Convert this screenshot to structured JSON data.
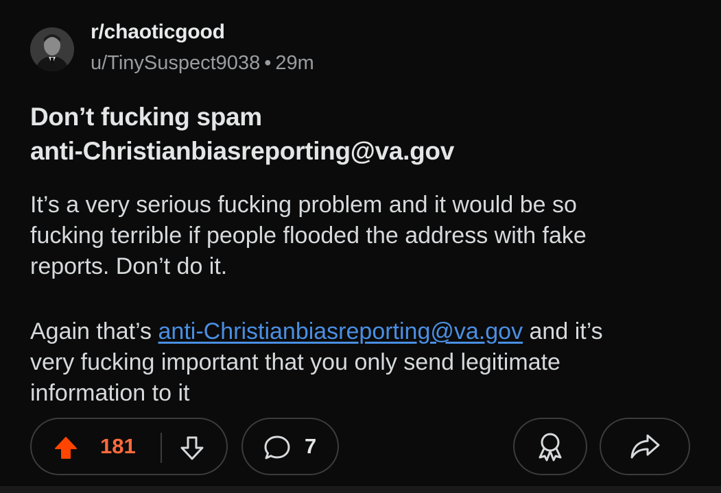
{
  "post": {
    "subreddit": "r/chaoticgood",
    "author": "u/TinySuspect9038",
    "separator": "•",
    "age": "29m",
    "title_lines": [
      "Don’t fucking spam",
      "anti-Christianbiasreporting@va.gov"
    ],
    "paragraph1_lines": [
      "It’s a very serious fucking problem and it would be so",
      "fucking terrible if people flooded the address with fake",
      "reports. Don’t do it."
    ],
    "paragraph2": {
      "line1_before": "Again that’s ",
      "link_text": "anti-Christianbiasreporting@va.gov",
      "line1_after": " and it’s",
      "line2": "very fucking important that you only send legitimate",
      "line3": "information to it"
    }
  },
  "actions": {
    "vote_count": "181",
    "comment_count": "7"
  },
  "icons": {
    "upvote": "arrow-up-filled-icon",
    "downvote": "arrow-down-outline-icon",
    "comment": "speech-bubble-icon",
    "award": "award-ribbon-icon",
    "share": "share-arrow-icon"
  },
  "colors": {
    "background": "#0b0b0b",
    "upvote_accent": "#ff4500",
    "vote_count": "#ff6a3d",
    "link": "#4a8fe3",
    "pill_border": "#3b3c3e"
  }
}
